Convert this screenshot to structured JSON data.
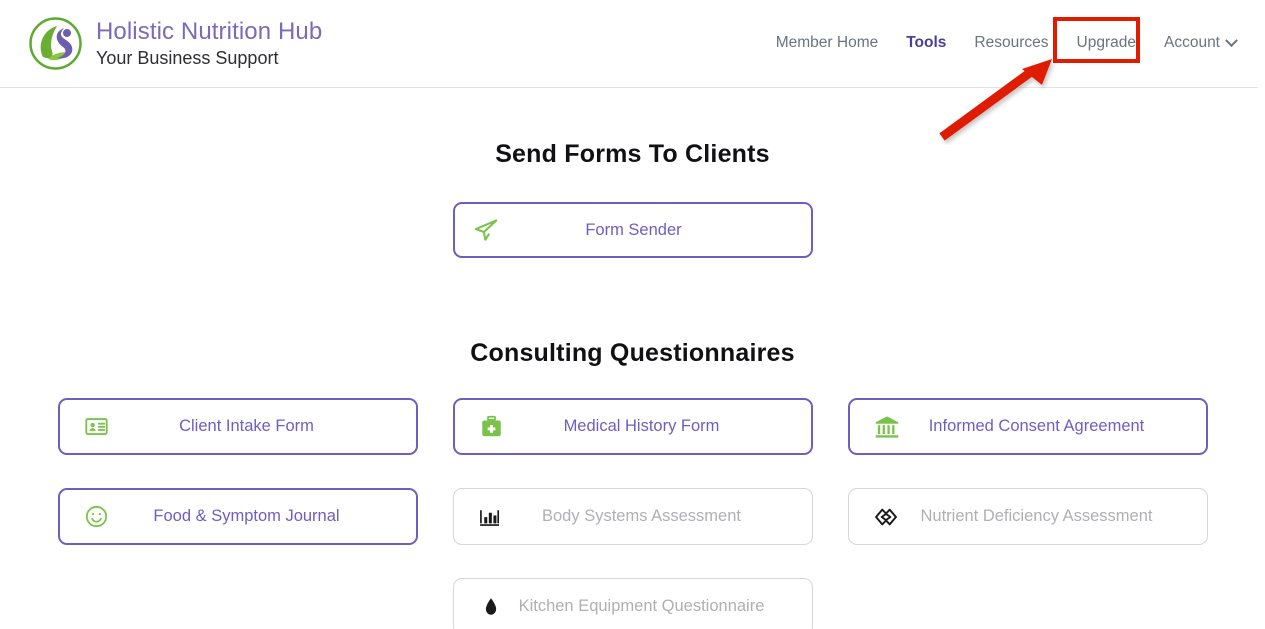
{
  "brand": {
    "title": "Holistic Nutrition Hub",
    "subtitle": "Your Business Support",
    "logo_icon": "leaf-circle-logo",
    "title_color": "#7b6bb5"
  },
  "nav": {
    "items": [
      {
        "label": "Member Home",
        "active": false,
        "name": "nav-member-home"
      },
      {
        "label": "Tools",
        "active": true,
        "name": "nav-tools"
      },
      {
        "label": "Resources",
        "active": false,
        "name": "nav-resources"
      },
      {
        "label": "Upgrade",
        "active": false,
        "name": "nav-upgrade"
      },
      {
        "label": "Account",
        "active": false,
        "name": "nav-account"
      }
    ],
    "account_chevron_icon": "chevron-down-icon",
    "active_color": "#4b3f9e",
    "inactive_color": "#6b7280"
  },
  "annotation": {
    "highlight_target": "Upgrade",
    "box_color": "#e01b00",
    "arrow_color": "#e01b00",
    "arrow_icon": "arrow-up-right-icon"
  },
  "sections": [
    {
      "title": "Send Forms To Clients",
      "name": "section-send-forms",
      "cards": [
        {
          "label": "Form Sender",
          "icon": "paper-plane-send-icon",
          "icon_color": "#79c34a",
          "disabled": false,
          "name": "card-form-sender"
        }
      ]
    },
    {
      "title": "Consulting Questionnaires",
      "name": "section-consulting-questionnaires",
      "cards": [
        {
          "label": "Client Intake Form",
          "icon": "id-card-icon",
          "icon_color": "#79c34a",
          "disabled": false,
          "name": "card-client-intake-form"
        },
        {
          "label": "Medical History Form",
          "icon": "medical-kit-icon",
          "icon_color": "#79c34a",
          "disabled": false,
          "name": "card-medical-history-form"
        },
        {
          "label": "Informed Consent Agreement",
          "icon": "bank-building-icon",
          "icon_color": "#79c34a",
          "disabled": false,
          "name": "card-informed-consent-agreement"
        },
        {
          "label": "Food & Symptom Journal",
          "icon": "smiley-face-icon",
          "icon_color": "#79c34a",
          "disabled": false,
          "name": "card-food-symptom-journal"
        },
        {
          "label": "Body Systems Assessment",
          "icon": "bar-chart-icon",
          "icon_color": "#1a1a1a",
          "disabled": true,
          "name": "card-body-systems-assessment"
        },
        {
          "label": "Nutrient Deficiency Assessment",
          "icon": "gem-diamond-icon",
          "icon_color": "#1a1a1a",
          "disabled": true,
          "name": "card-nutrient-deficiency-assessment"
        }
      ],
      "clipped_card": {
        "label": "Kitchen Equipment Questionnaire",
        "icon": "droplet-icon",
        "icon_color": "#1a1a1a",
        "disabled": true,
        "name": "card-kitchen-equipment-questionnaire"
      }
    }
  ],
  "theme": {
    "accent_purple": "#6c5fc0",
    "accent_green": "#79c34a",
    "disabled_text": "#b0b0b4",
    "disabled_border": "#d6d6d8",
    "heading_color": "#111114"
  }
}
